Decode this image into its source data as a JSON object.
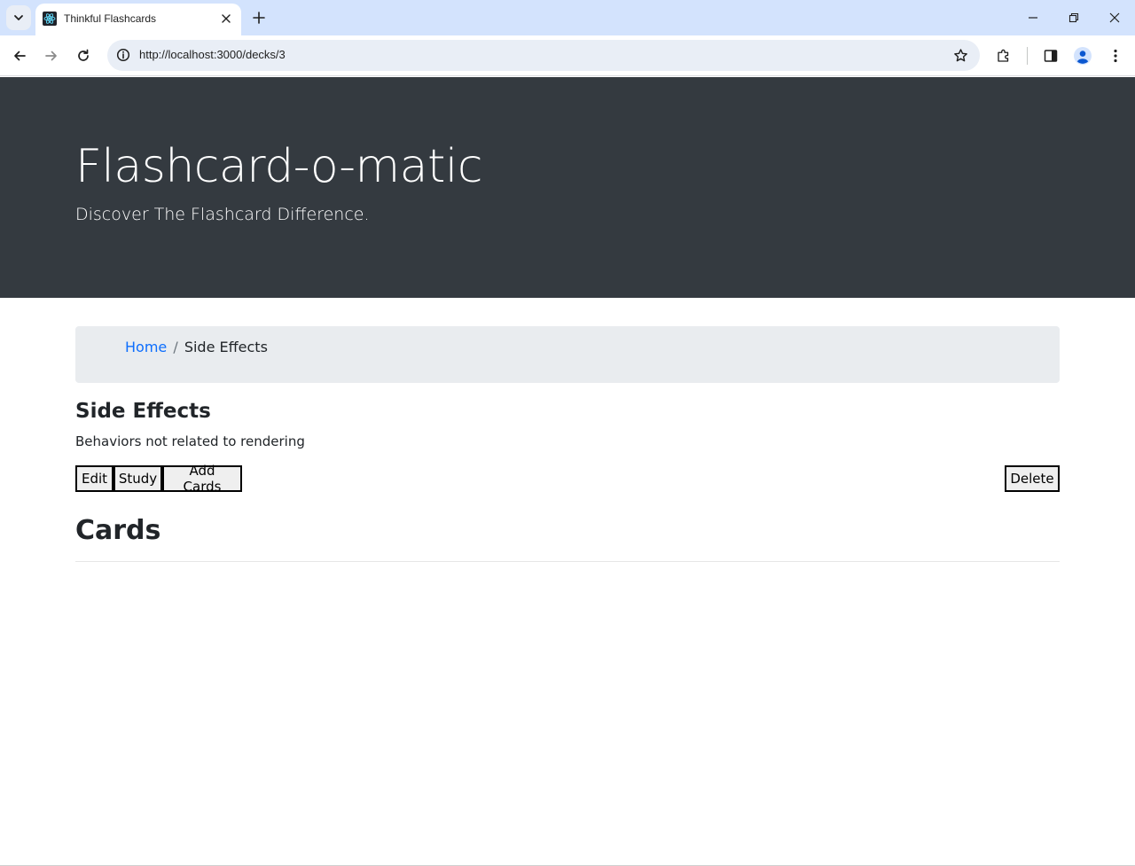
{
  "browser": {
    "tab_title": "Thinkful Flashcards",
    "url": "http://localhost:3000/decks/3",
    "icons": {
      "tab_search": "chevron-down-icon",
      "favicon": "react-icon",
      "tab_close": "close-icon",
      "new_tab": "plus-icon",
      "back": "arrow-left-icon",
      "forward": "arrow-right-icon",
      "reload": "reload-icon",
      "site_info": "info-icon",
      "bookmark": "star-icon",
      "extensions": "puzzle-icon",
      "side_panel": "side-panel-icon",
      "profile": "profile-icon",
      "menu": "kebab-menu-icon",
      "minimize": "minimize-icon",
      "restore": "restore-icon",
      "close_window": "close-icon"
    }
  },
  "header": {
    "title": "Flashcard-o-matic",
    "lead": "Discover The Flashcard Difference."
  },
  "breadcrumb": {
    "home_label": "Home",
    "separator": "/",
    "current": "Side Effects"
  },
  "deck": {
    "name": "Side Effects",
    "description": "Behaviors not related to rendering"
  },
  "actions": {
    "edit_label": "Edit",
    "study_label": "Study",
    "add_cards_label": "Add Cards",
    "delete_label": "Delete"
  },
  "cards": {
    "heading": "Cards",
    "items": []
  },
  "colors": {
    "header_bg": "#343a40",
    "breadcrumb_bg": "#e9ecef",
    "link": "#0d6efd",
    "tabstrip_bg": "#d3e3fd",
    "omnibox_bg": "#e9eef6"
  }
}
